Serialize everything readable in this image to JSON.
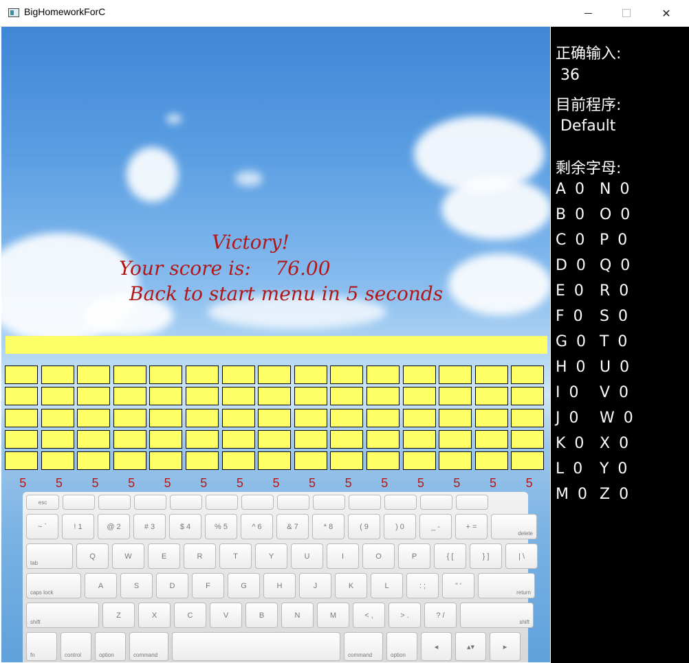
{
  "window": {
    "title": "BigHomeworkForC",
    "minimize": "—",
    "maximize": "□",
    "close": "✕"
  },
  "message": {
    "victory": "Victory!",
    "score_line": "Your score is:    76.00",
    "back_line": "Back to start menu in 5 seconds"
  },
  "grid": {
    "rows": 5,
    "cols": 15
  },
  "column_counts": [
    "5",
    "5",
    "5",
    "5",
    "5",
    "5",
    "5",
    "5",
    "5",
    "5",
    "5",
    "5",
    "5",
    "5",
    "5"
  ],
  "keyboard": {
    "row0": [
      "esc",
      "",
      "",
      "",
      "",
      "",
      "",
      "",
      "",
      "",
      "",
      "",
      ""
    ],
    "row1": [
      "~ `",
      "! 1",
      "@ 2",
      "# 3",
      "$ 4",
      "% 5",
      "^ 6",
      "& 7",
      "* 8",
      "( 9",
      ") 0",
      "_ -",
      "+ =",
      "delete"
    ],
    "row2": [
      "tab",
      "Q",
      "W",
      "E",
      "R",
      "T",
      "Y",
      "U",
      "I",
      "O",
      "P",
      "{ [",
      "} ]",
      "| \\"
    ],
    "row3": [
      "caps lock",
      "A",
      "S",
      "D",
      "F",
      "G",
      "H",
      "J",
      "K",
      "L",
      ": ;",
      "\" '",
      "return"
    ],
    "row4": [
      "shift",
      "Z",
      "X",
      "C",
      "V",
      "B",
      "N",
      "M",
      "< ,",
      "> .",
      "? /",
      "shift"
    ],
    "row5": [
      "fn",
      "control",
      "option",
      "command",
      "",
      "command",
      "option",
      "◂",
      "▴▾",
      "▸"
    ]
  },
  "panel": {
    "correct_label": "正确输入:",
    "correct_value": "36",
    "program_label": "目前程序:",
    "program_value": "Default",
    "remaining_label": "剩余字母:",
    "letters": [
      [
        "A 0",
        "N 0"
      ],
      [
        "B 0",
        "O 0"
      ],
      [
        "C 0",
        "P 0"
      ],
      [
        "D 0",
        "Q 0"
      ],
      [
        "E 0",
        "R 0"
      ],
      [
        "F 0",
        "S 0"
      ],
      [
        "G 0",
        "T 0"
      ],
      [
        "H 0",
        "U 0"
      ],
      [
        "I  0",
        "V 0"
      ],
      [
        "J  0",
        "W 0"
      ],
      [
        "K 0",
        "X 0"
      ],
      [
        "L 0",
        "Y 0"
      ],
      [
        "M 0",
        "Z 0"
      ]
    ]
  },
  "colors": {
    "highlight": "#ffff66",
    "message": "#b01818",
    "panel_bg": "#000000"
  }
}
